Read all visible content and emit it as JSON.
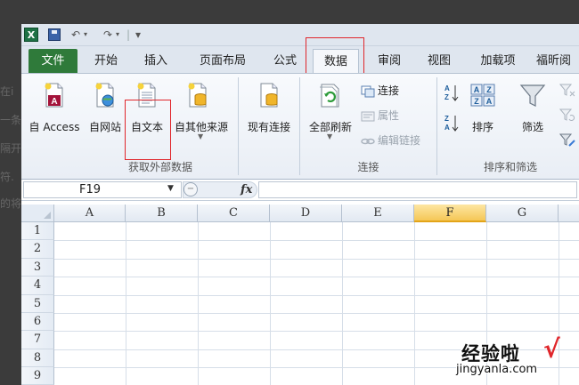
{
  "background_fragments": [
    "在i",
    "一条",
    "隔开",
    "符.",
    "的将"
  ],
  "window": {
    "quick_access": {
      "app_icon": "excel-icon",
      "save_icon": "save-icon",
      "undo_symbol": "↶",
      "redo_symbol": "↷",
      "customize_symbol": "▾"
    },
    "tabs": [
      {
        "label": "文件",
        "active": false
      },
      {
        "label": "开始",
        "active": false
      },
      {
        "label": "插入",
        "active": false
      },
      {
        "label": "页面布局",
        "active": false
      },
      {
        "label": "公式",
        "active": false
      },
      {
        "label": "数据",
        "active": true
      },
      {
        "label": "审阅",
        "active": false
      },
      {
        "label": "视图",
        "active": false
      },
      {
        "label": "加载项",
        "active": false
      },
      {
        "label": "福昕阅",
        "active": false
      }
    ],
    "ribbon": {
      "groups": {
        "external": {
          "label": "获取外部数据",
          "buttons": [
            {
              "label": "自 Access",
              "icon": "access-database-icon"
            },
            {
              "label": "自网站",
              "icon": "web-globe-icon"
            },
            {
              "label": "自文本",
              "icon": "text-file-icon",
              "highlighted": true
            },
            {
              "label": "自其他来源",
              "icon": "other-sources-icon"
            },
            {
              "label": "现有连接",
              "icon": "existing-connections-icon"
            }
          ]
        },
        "connections": {
          "label": "连接",
          "refresh_label": "全部刷新",
          "items": [
            {
              "label": "连接",
              "enabled": true
            },
            {
              "label": "属性",
              "enabled": false
            },
            {
              "label": "编辑链接",
              "enabled": false
            }
          ]
        },
        "sort_filter": {
          "label": "排序和筛选",
          "sort_label": "排序",
          "filter_label": "筛选"
        }
      }
    },
    "formula_bar": {
      "name_box_value": "F19",
      "fx_label": "fx",
      "formula_value": ""
    },
    "sheet": {
      "columns": [
        "A",
        "B",
        "C",
        "D",
        "E",
        "F",
        "G"
      ],
      "selected_column": "F",
      "rows": [
        "1",
        "2",
        "3",
        "4",
        "5",
        "6",
        "7",
        "8",
        "9"
      ]
    }
  },
  "watermark": {
    "title": "经验啦",
    "check": "√",
    "url": "jingyanla.com"
  },
  "colors": {
    "file_tab": "#2f7a3a",
    "highlight_box": "#e0262b",
    "selected_column": "#f5c756"
  }
}
